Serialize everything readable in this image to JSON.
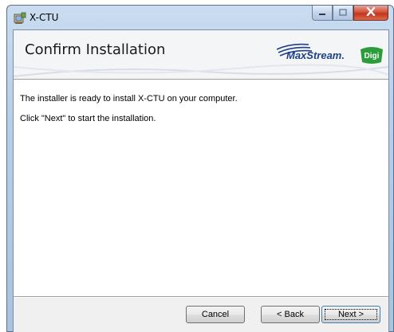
{
  "window": {
    "title": "X-CTU",
    "icon": "installer-icon",
    "caption": {
      "minimize": "minimize-icon",
      "maximize": "maximize-icon",
      "close": "close-icon"
    }
  },
  "banner": {
    "title": "Confirm Installation",
    "logo_maxstream": "MaxStream.",
    "logo_digi": "Digi"
  },
  "body": {
    "line1": "The installer is ready to install X-CTU on your computer.",
    "line2": "Click \"Next\" to start the installation."
  },
  "buttons": {
    "cancel": "Cancel",
    "back": "< Back",
    "next": "Next >"
  },
  "colors": {
    "frame": "#b5cde7",
    "close_button": "#c2351c",
    "maxstream_blue": "#1f3f8a",
    "digi_green": "#2a9d3a"
  }
}
